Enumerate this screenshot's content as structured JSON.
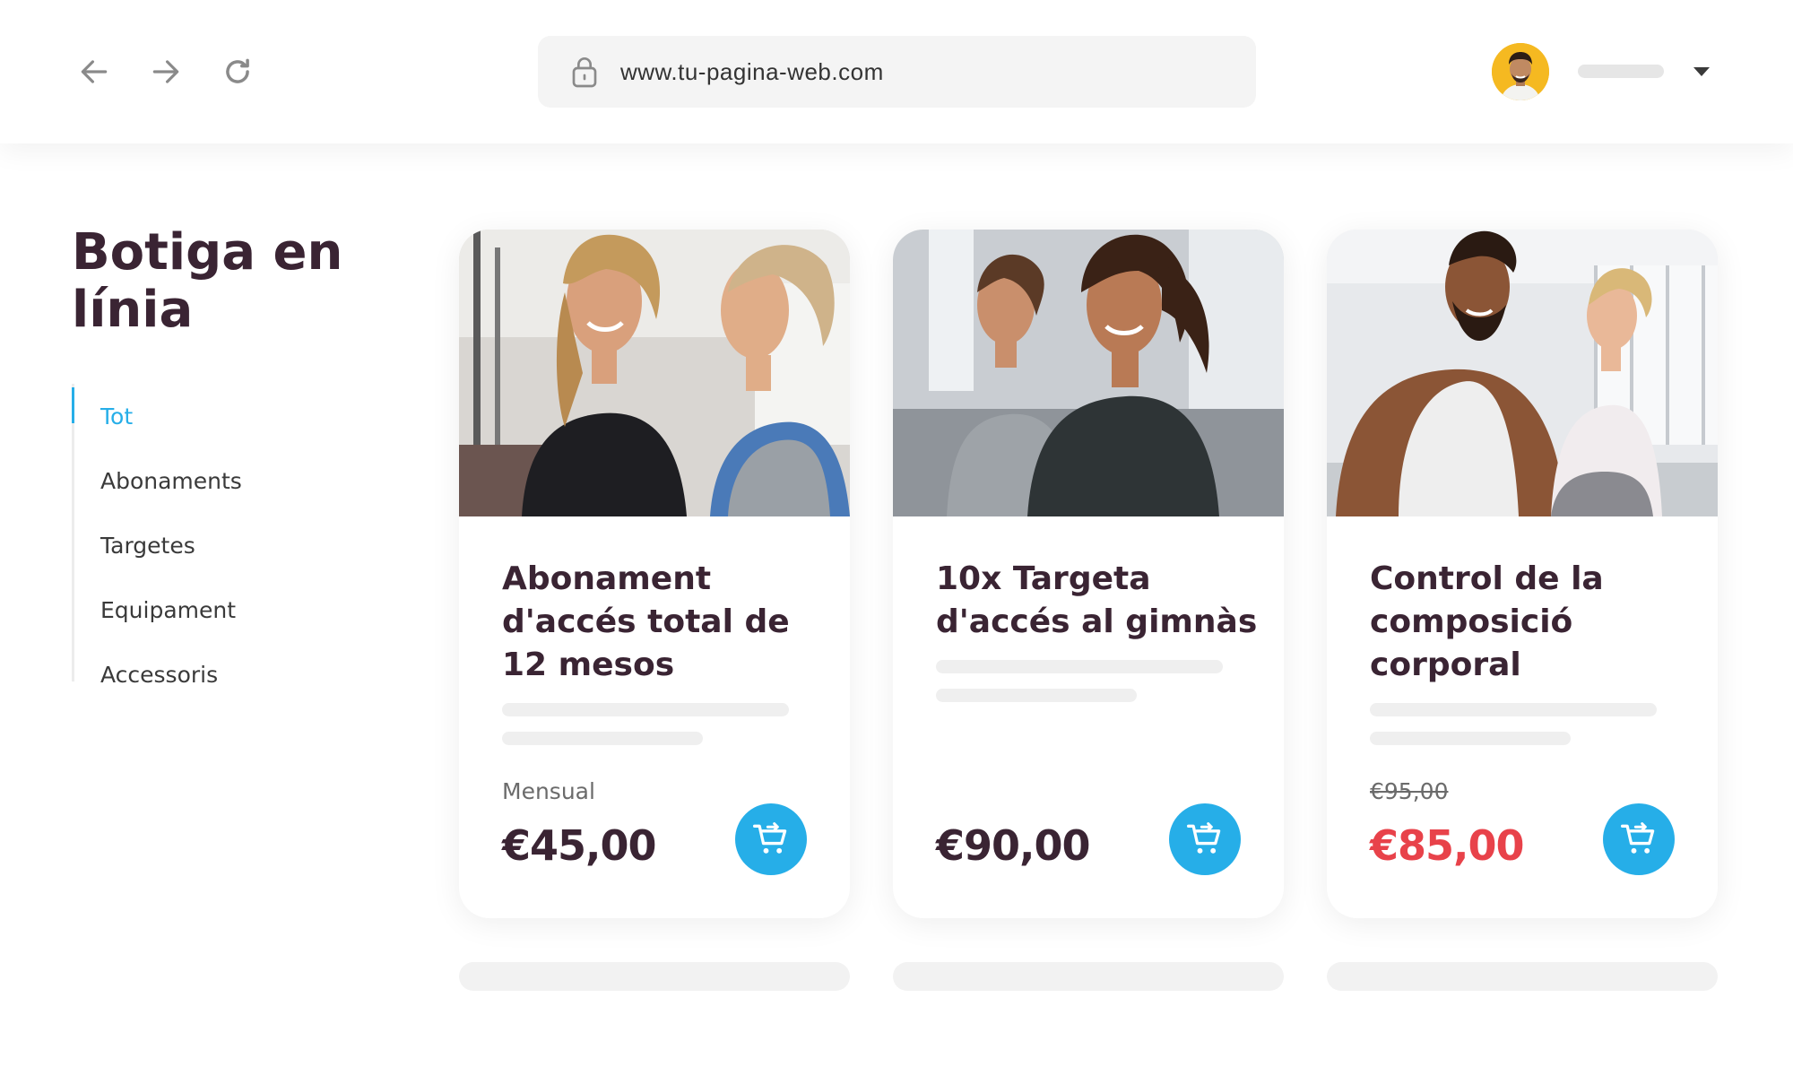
{
  "browser": {
    "url": "www.tu-pagina-web.com",
    "icons": {
      "back": "arrow-left-icon",
      "forward": "arrow-right-icon",
      "reload": "reload-icon",
      "lock": "lock-icon",
      "caret": "chevron-down-icon",
      "cart": "add-to-cart-icon"
    }
  },
  "sidebar": {
    "title": "Botiga en línia",
    "categories": [
      {
        "label": "Tot",
        "active": true
      },
      {
        "label": "Abonaments",
        "active": false
      },
      {
        "label": "Targetes",
        "active": false
      },
      {
        "label": "Equipament",
        "active": false
      },
      {
        "label": "Accessoris",
        "active": false
      }
    ]
  },
  "products": [
    {
      "title": "Abonament d'accés total de 12 mesos",
      "note": "Mensual",
      "price": "€45,00"
    },
    {
      "title": "10x Targeta d'accés al gimnàs",
      "note": "",
      "price": "€90,00"
    },
    {
      "title": "Control de la composició corporal",
      "old_price": "€95,00",
      "price": "€85,00"
    }
  ],
  "colors": {
    "accent": "#26aee8",
    "title_text": "#3a2433",
    "sale_price": "#e8424a",
    "avatar_bg": "#f5b921"
  }
}
